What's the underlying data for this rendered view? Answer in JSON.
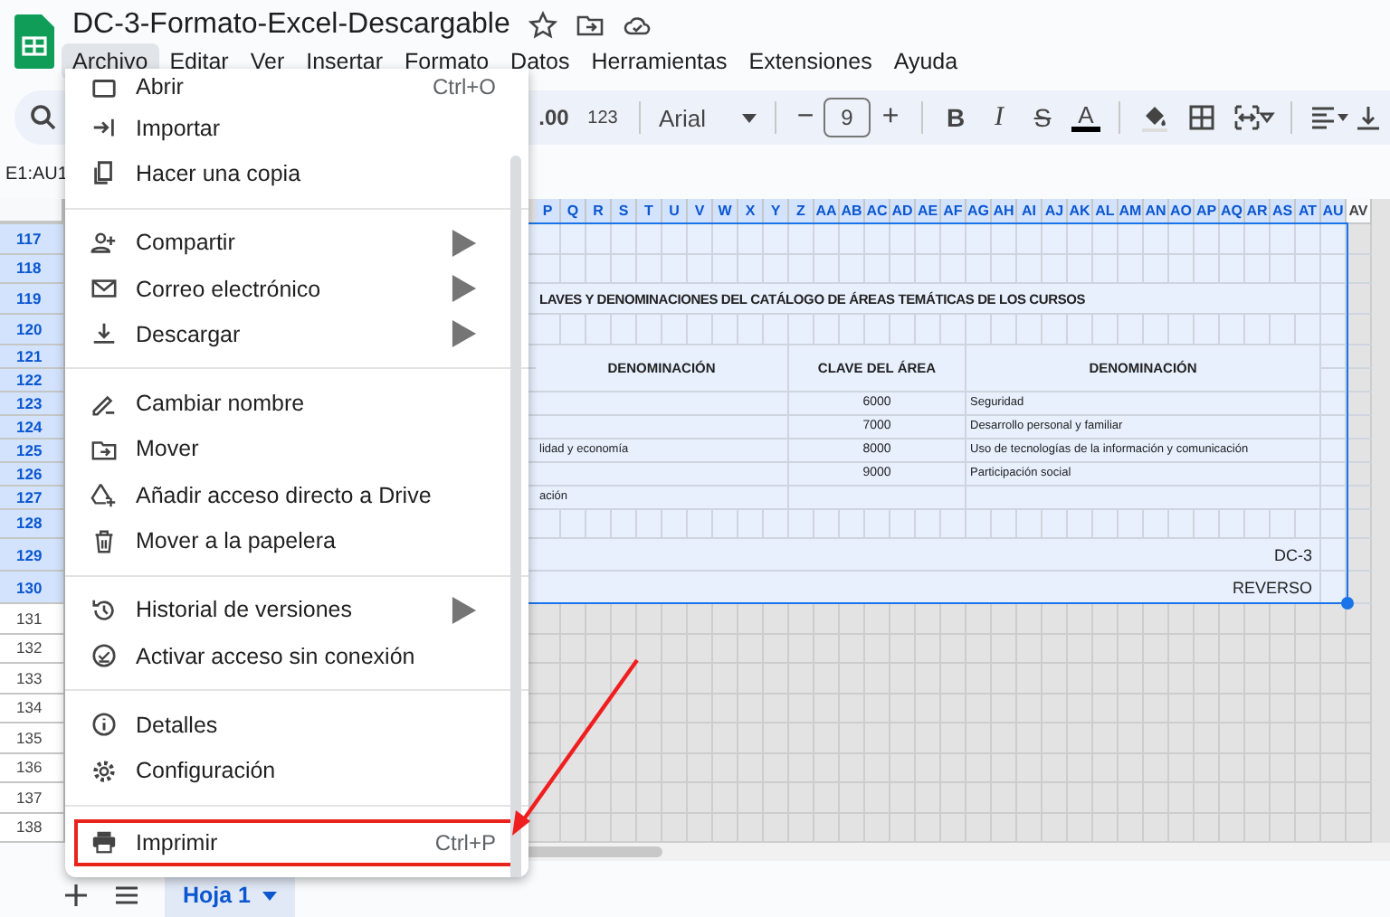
{
  "app": {
    "title": "DC-3-Formato-Excel-Descargable"
  },
  "menubar": [
    {
      "label": "Archivo",
      "selected": true
    },
    {
      "label": "Editar",
      "selected": false
    },
    {
      "label": "Ver",
      "selected": false
    },
    {
      "label": "Insertar",
      "selected": false
    },
    {
      "label": "Formato",
      "selected": false
    },
    {
      "label": "Datos",
      "selected": false
    },
    {
      "label": "Herramientas",
      "selected": false
    },
    {
      "label": "Extensiones",
      "selected": false
    },
    {
      "label": "Ayuda",
      "selected": false
    }
  ],
  "toolbar": {
    "decimal": ".00",
    "number_format": "123",
    "font": "Arial",
    "decrease": "−",
    "font_size": "9",
    "increase": "+",
    "bold": "B",
    "italic": "I",
    "strikethrough": "S",
    "text_color": "A"
  },
  "name_box": "E1:AU1",
  "menu": {
    "items": [
      {
        "kind": "item",
        "label": "Abrir",
        "shortcut": "Ctrl+O",
        "submenu": false,
        "highlighted": false
      },
      {
        "kind": "item",
        "label": "Importar",
        "submenu": false,
        "highlighted": false
      },
      {
        "kind": "item",
        "label": "Hacer una copia",
        "submenu": false,
        "highlighted": false
      },
      {
        "kind": "divider"
      },
      {
        "kind": "item",
        "label": "Compartir",
        "submenu": true,
        "highlighted": false
      },
      {
        "kind": "item",
        "label": "Correo electrónico",
        "submenu": true,
        "highlighted": false
      },
      {
        "kind": "item",
        "label": "Descargar",
        "submenu": true,
        "highlighted": false
      },
      {
        "kind": "divider"
      },
      {
        "kind": "item",
        "label": "Cambiar nombre",
        "submenu": false,
        "highlighted": false
      },
      {
        "kind": "item",
        "label": "Mover",
        "submenu": false,
        "highlighted": false
      },
      {
        "kind": "item",
        "label": "Añadir acceso directo a Drive",
        "submenu": false,
        "highlighted": false
      },
      {
        "kind": "item",
        "label": "Mover a la papelera",
        "submenu": false,
        "highlighted": false
      },
      {
        "kind": "divider"
      },
      {
        "kind": "item",
        "label": "Historial de versiones",
        "submenu": true,
        "highlighted": false
      },
      {
        "kind": "item",
        "label": "Activar acceso sin conexión",
        "submenu": false,
        "highlighted": false
      },
      {
        "kind": "divider"
      },
      {
        "kind": "item",
        "label": "Detalles",
        "submenu": false,
        "highlighted": false
      },
      {
        "kind": "item",
        "label": "Configuración",
        "submenu": false,
        "highlighted": false
      },
      {
        "kind": "divider"
      },
      {
        "kind": "item",
        "label": "Imprimir",
        "shortcut": "Ctrl+P",
        "submenu": false,
        "highlighted": true
      }
    ]
  },
  "sheet": {
    "columns": [
      {
        "label": "P",
        "selected": true
      },
      {
        "label": "Q",
        "selected": true
      },
      {
        "label": "R",
        "selected": true
      },
      {
        "label": "S",
        "selected": true
      },
      {
        "label": "T",
        "selected": true
      },
      {
        "label": "U",
        "selected": true
      },
      {
        "label": "V",
        "selected": true
      },
      {
        "label": "W",
        "selected": true
      },
      {
        "label": "X",
        "selected": true
      },
      {
        "label": "Y",
        "selected": true
      },
      {
        "label": "Z",
        "selected": true
      },
      {
        "label": "AA",
        "selected": true
      },
      {
        "label": "AB",
        "selected": true
      },
      {
        "label": "AC",
        "selected": true
      },
      {
        "label": "AD",
        "selected": true
      },
      {
        "label": "AE",
        "selected": true
      },
      {
        "label": "AF",
        "selected": true
      },
      {
        "label": "AG",
        "selected": true
      },
      {
        "label": "AH",
        "selected": true
      },
      {
        "label": "AI",
        "selected": true
      },
      {
        "label": "AJ",
        "selected": true
      },
      {
        "label": "AK",
        "selected": true
      },
      {
        "label": "AL",
        "selected": true
      },
      {
        "label": "AM",
        "selected": true
      },
      {
        "label": "AN",
        "selected": true
      },
      {
        "label": "AO",
        "selected": true
      },
      {
        "label": "AP",
        "selected": true
      },
      {
        "label": "AQ",
        "selected": true
      },
      {
        "label": "AR",
        "selected": true
      },
      {
        "label": "AS",
        "selected": true
      },
      {
        "label": "AT",
        "selected": true
      },
      {
        "label": "AU",
        "selected": true
      },
      {
        "label": "AV",
        "selected": false
      }
    ],
    "rows": [
      {
        "number": "117",
        "selected": true,
        "kind": "grid"
      },
      {
        "number": "118",
        "selected": true,
        "kind": "grid"
      },
      {
        "number": "119",
        "selected": true,
        "kind": "title",
        "title": "LAVES Y DENOMINACIONES DEL CATÁLOGO DE ÁREAS TEMÁTICAS DE LOS CURSOS"
      },
      {
        "number": "120",
        "selected": true,
        "kind": "grid"
      },
      {
        "number": "121",
        "selected": true,
        "kind": "header",
        "denominacion_1": "DENOMINACIÓN",
        "clave_del_area": "CLAVE DEL ÁREA",
        "denominacion_2": "DENOMINACIÓN"
      },
      {
        "number": "122",
        "selected": true,
        "kind": "continued"
      },
      {
        "number": "123",
        "selected": true,
        "kind": "data",
        "clave_del_area": "6000",
        "denominacion_2": "Seguridad"
      },
      {
        "number": "124",
        "selected": true,
        "kind": "data",
        "clave_del_area": "7000",
        "denominacion_2": "Desarrollo personal y familiar"
      },
      {
        "number": "125",
        "selected": true,
        "kind": "data",
        "denominacion_1": "lidad y economía",
        "clave_del_area": "8000",
        "denominacion_2": "Uso de tecnologías de la información y  comunicación"
      },
      {
        "number": "126",
        "selected": true,
        "kind": "data",
        "clave_del_area": "9000",
        "denominacion_2": "Participación social"
      },
      {
        "number": "127",
        "selected": true,
        "kind": "data",
        "denominacion_1": "ación"
      },
      {
        "number": "128",
        "selected": true,
        "kind": "grid"
      },
      {
        "number": "129",
        "selected": true,
        "kind": "right",
        "note": "DC-3"
      },
      {
        "number": "130",
        "selected": true,
        "kind": "right",
        "note": "REVERSO"
      },
      {
        "number": "131",
        "selected": false,
        "kind": "grid"
      },
      {
        "number": "132",
        "selected": false,
        "kind": "grid"
      },
      {
        "number": "133",
        "selected": false,
        "kind": "grid"
      },
      {
        "number": "134",
        "selected": false,
        "kind": "grid"
      },
      {
        "number": "135",
        "selected": false,
        "kind": "grid"
      },
      {
        "number": "136",
        "selected": false,
        "kind": "grid"
      },
      {
        "number": "137",
        "selected": false,
        "kind": "grid"
      },
      {
        "number": "138",
        "selected": false,
        "kind": "grid"
      }
    ]
  },
  "sheet_tabs": [
    {
      "label": "Hoja 1",
      "selected": true
    }
  ]
}
